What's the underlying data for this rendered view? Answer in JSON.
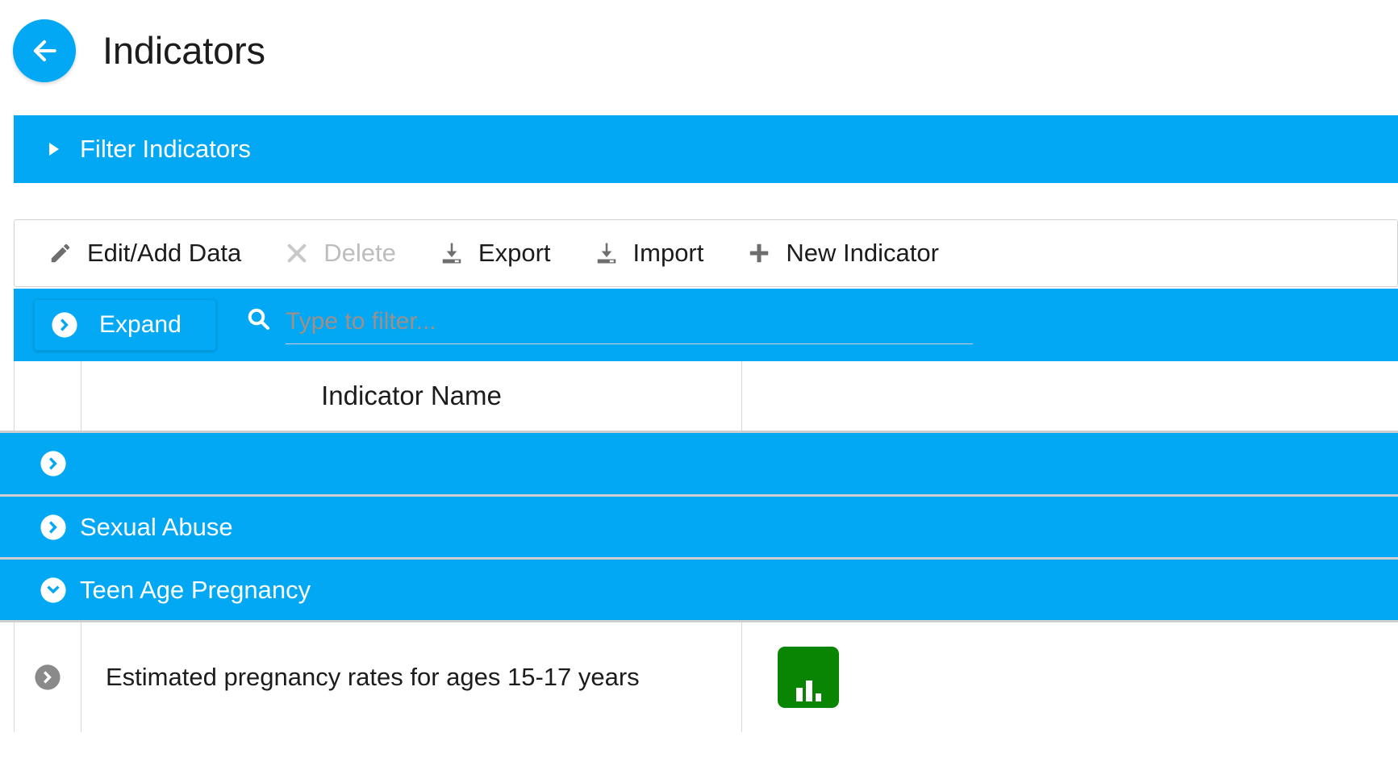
{
  "header": {
    "back_icon": "arrow-left-icon",
    "title": "Indicators"
  },
  "filter_panel": {
    "label": "Filter Indicators",
    "caret_icon": "caret-right-icon",
    "expanded": false
  },
  "toolbar": {
    "items": [
      {
        "label": "Edit/Add Data",
        "icon": "pencil-icon",
        "disabled": false
      },
      {
        "label": "Delete",
        "icon": "times-icon",
        "disabled": true
      },
      {
        "label": "Export",
        "icon": "download-icon",
        "disabled": false
      },
      {
        "label": "Import",
        "icon": "upload-icon",
        "disabled": false
      },
      {
        "label": "New Indicator",
        "icon": "plus-icon",
        "disabled": false
      }
    ]
  },
  "controls": {
    "expand_label": "Expand",
    "expand_icon": "chevron-circle-right-icon",
    "search_icon": "search-icon",
    "search_placeholder": "Type to filter...",
    "search_value": ""
  },
  "table": {
    "columns": [
      "",
      "",
      "Indicator Name",
      ""
    ],
    "groups": [
      {
        "label": "",
        "icon": "chevron-circle-right-icon",
        "expanded": false
      },
      {
        "label": "Sexual Abuse",
        "icon": "chevron-circle-right-icon",
        "expanded": false
      },
      {
        "label": "Teen Age Pregnancy",
        "icon": "chevron-circle-down-icon",
        "expanded": true
      }
    ],
    "rows": [
      {
        "toggle_icon": "chevron-circle-right-icon",
        "name": "Estimated pregnancy rates for ages 15-17 years",
        "badge_icon": "bar-chart-icon"
      }
    ]
  },
  "colors": {
    "accent_blue": "#02a8f3",
    "badge_green": "#0a8403",
    "disabled_gray": "#bdbdbd",
    "border_gray": "#cfcfcf"
  }
}
